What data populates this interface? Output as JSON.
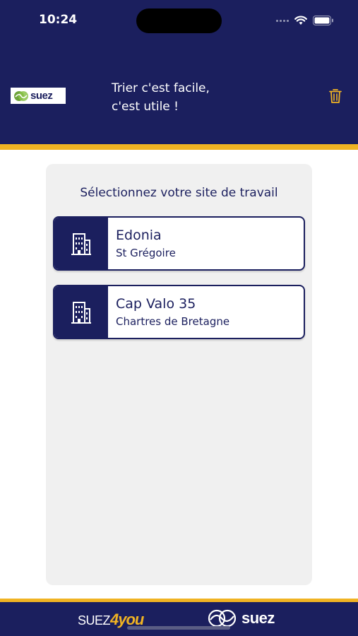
{
  "status_bar": {
    "time": "10:24"
  },
  "header": {
    "logo_text": "suez",
    "slogan_line1": "Trier c'est facile,",
    "slogan_line2": "c'est utile !"
  },
  "panel": {
    "title": "Sélectionnez votre site de travail",
    "sites": [
      {
        "name": "Edonia",
        "location": "St Grégoire",
        "icon": "building-icon"
      },
      {
        "name": "Cap Valo 35",
        "location": "Chartres de Bretagne",
        "icon": "building-icon"
      }
    ]
  },
  "footer": {
    "brand_suez": "SUEZ",
    "brand_4you": "4you",
    "logo_text": "suez"
  },
  "colors": {
    "primary": "#1b1f5e",
    "accent": "#f0b323",
    "panel": "#f0f0f0"
  }
}
